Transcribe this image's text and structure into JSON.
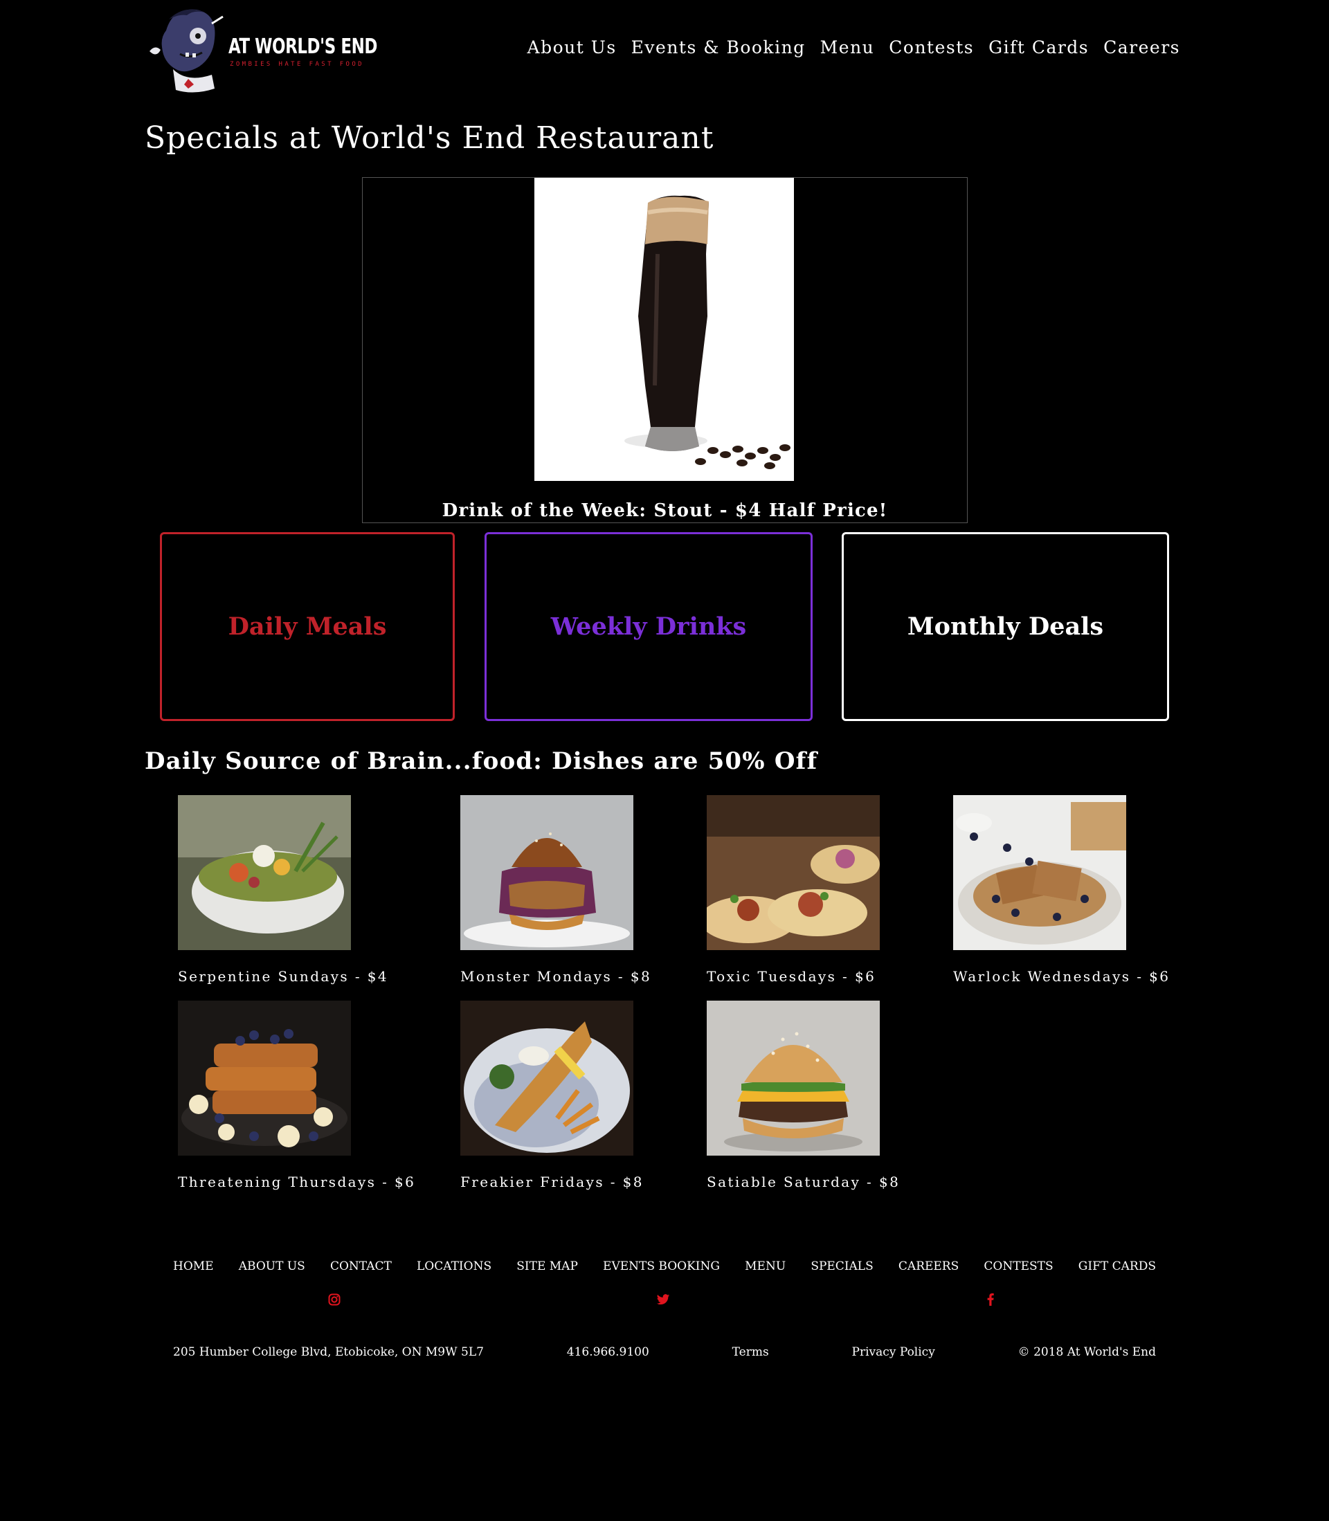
{
  "brand": {
    "name": "AT WORLD'S END",
    "tagline": "ZOMBIES HATE FAST FOOD",
    "accent": "#d3202f"
  },
  "nav": {
    "items": [
      {
        "label": "About Us"
      },
      {
        "label": "Events & Booking"
      },
      {
        "label": "Menu"
      },
      {
        "label": "Contests"
      },
      {
        "label": "Gift Cards"
      },
      {
        "label": "Careers"
      }
    ]
  },
  "page": {
    "title": "Specials at World's End Restaurant"
  },
  "feature": {
    "caption": "Drink of the Week: Stout - $4 Half Price!"
  },
  "categories": [
    {
      "label": "Daily Meals",
      "color": "#c0222a"
    },
    {
      "label": "Weekly Drinks",
      "color": "#7b2fd8"
    },
    {
      "label": "Monthly Deals",
      "color": "#ffffff"
    }
  ],
  "daily": {
    "title": "Daily Source of Brain...food: Dishes are 50% Off",
    "dishes": [
      {
        "label": "Serpentine Sundays - $4",
        "image": "salad"
      },
      {
        "label": "Monster Mondays - $8",
        "image": "pulled-chicken-burger"
      },
      {
        "label": "Toxic Tuesdays - $6",
        "image": "tacos"
      },
      {
        "label": "Warlock Wednesdays - $6",
        "image": "waffles"
      },
      {
        "label": "Threatening Thursdays - $6",
        "image": "french-toast"
      },
      {
        "label": "Freakier Fridays - $8",
        "image": "fish-and-chips"
      },
      {
        "label": "Satiable Saturday - $8",
        "image": "cheeseburger"
      }
    ]
  },
  "footer": {
    "links": [
      {
        "label": "HOME"
      },
      {
        "label": "ABOUT US"
      },
      {
        "label": "CONTACT"
      },
      {
        "label": "LOCATIONS"
      },
      {
        "label": "SITE MAP"
      },
      {
        "label": "EVENTS BOOKING"
      },
      {
        "label": "MENU"
      },
      {
        "label": "SPECIALS"
      },
      {
        "label": "CAREERS"
      },
      {
        "label": "CONTESTS"
      },
      {
        "label": "GIFT CARDS"
      }
    ],
    "social": [
      {
        "icon": "instagram-icon"
      },
      {
        "icon": "twitter-icon"
      },
      {
        "icon": "facebook-icon"
      }
    ],
    "social_color": "#e0141e",
    "address": "205 Humber College Blvd, Etobicoke, ON M9W 5L7",
    "phone": "416.966.9100",
    "terms": "Terms",
    "privacy": "Privacy Policy",
    "copyright": "© 2018 At World's End"
  }
}
